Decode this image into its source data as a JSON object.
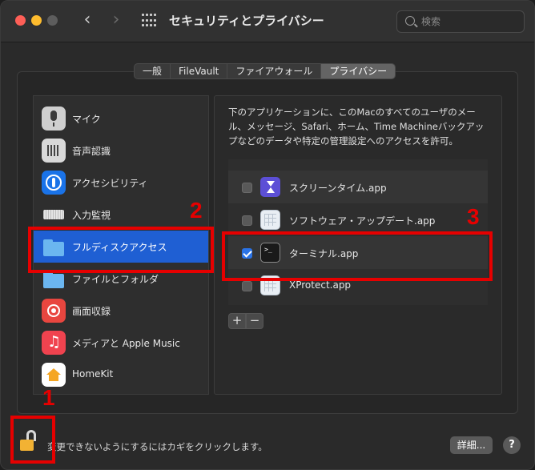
{
  "window": {
    "title": "セキュリティとプライバシー",
    "search_placeholder": "検索"
  },
  "nav": {
    "back": "‹",
    "forward": "›"
  },
  "tabs": [
    {
      "label": "一般",
      "active": false
    },
    {
      "label": "FileVault",
      "active": false
    },
    {
      "label": "ファイアウォール",
      "active": false
    },
    {
      "label": "プライバシー",
      "active": true
    }
  ],
  "sidebar": {
    "items": [
      {
        "label": "マイク",
        "icon": "microphone-icon"
      },
      {
        "label": "音声認識",
        "icon": "voice-waveform-icon"
      },
      {
        "label": "アクセシビリティ",
        "icon": "accessibility-icon"
      },
      {
        "label": "入力監視",
        "icon": "keyboard-icon"
      },
      {
        "label": "フルディスクアクセス",
        "icon": "folder-icon",
        "selected": true
      },
      {
        "label": "ファイルとフォルダ",
        "icon": "folder-icon"
      },
      {
        "label": "画面収録",
        "icon": "screen-record-icon"
      },
      {
        "label": "メディアと Apple Music",
        "icon": "music-icon"
      },
      {
        "label": "HomeKit",
        "icon": "home-icon"
      }
    ]
  },
  "detail": {
    "description": "下のアプリケーションに、このMacのすべてのユーザのメール、メッセージ、Safari、ホーム、Time Machineバックアップなどのデータや特定の管理設定へのアクセスを許可。",
    "apps": [
      {
        "label": "スクリーンタイム.app",
        "checked": false,
        "icon": "hourglass-icon"
      },
      {
        "label": "ソフトウェア・アップデート.app",
        "checked": false,
        "icon": "generic-app-icon"
      },
      {
        "label": "ターミナル.app",
        "checked": true,
        "icon": "terminal-icon"
      },
      {
        "label": "XProtect.app",
        "checked": false,
        "icon": "generic-app-icon"
      }
    ],
    "add_label": "+",
    "remove_label": "−"
  },
  "footer": {
    "lock_text": "変更できないようにするにはカギをクリックします。",
    "details_label": "詳細...",
    "help_label": "?"
  },
  "annotations": [
    {
      "label": "1",
      "color": "#e60000"
    },
    {
      "label": "2",
      "color": "#e60000"
    },
    {
      "label": "3",
      "color": "#e60000"
    }
  ],
  "colors": {
    "selection": "#1f5fd3",
    "annotation": "#e60000",
    "checkbox_checked": "#2a73e6"
  }
}
